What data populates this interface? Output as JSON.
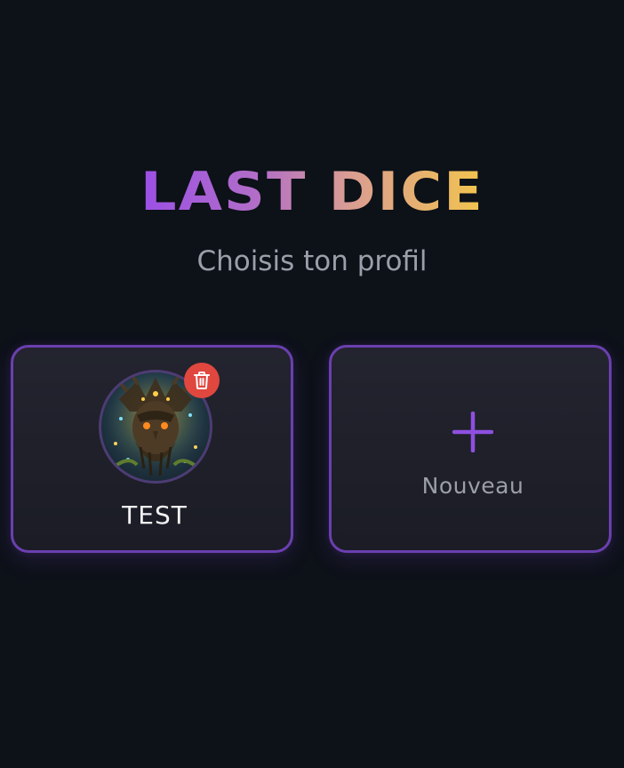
{
  "header": {
    "title": "LAST DICE",
    "subtitle": "Choisis ton profil"
  },
  "profiles": [
    {
      "name": "TEST"
    }
  ],
  "new_profile": {
    "label": "Nouveau"
  },
  "colors": {
    "background": "#0d1118",
    "card_border": "#6b3fb0",
    "title_gradient_start": "#9b4fe6",
    "title_gradient_end": "#f2c44d",
    "delete_button": "#e0473f",
    "plus_icon": "#8e4fe0"
  },
  "icons": {
    "delete": "trash-icon",
    "new": "plus-icon"
  }
}
